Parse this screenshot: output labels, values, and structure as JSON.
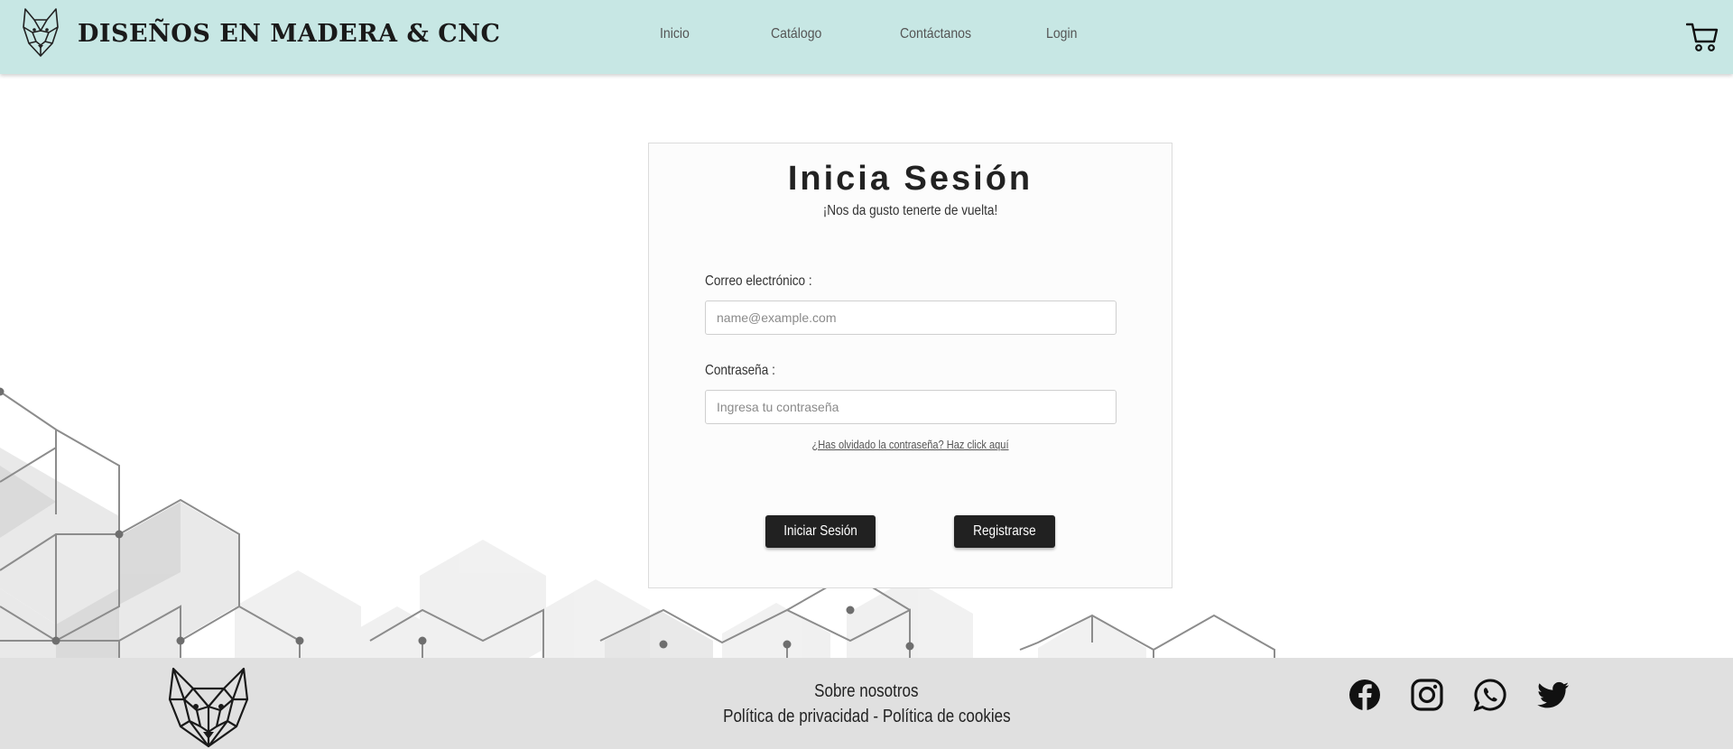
{
  "header": {
    "brand_name": "DISEÑOS EN MADERA & CNC",
    "logo_icon": "wolf-icon",
    "nav": [
      {
        "label": "Inicio"
      },
      {
        "label": "Catálogo"
      },
      {
        "label": "Contáctanos"
      },
      {
        "label": "Login"
      }
    ],
    "cart_icon": "cart-icon"
  },
  "login": {
    "title": "Inicia Sesión",
    "subtitle": "¡Nos da gusto tenerte de vuelta!",
    "email_label": "Correo electrónico :",
    "email_placeholder": "name@example.com",
    "email_value": "",
    "password_label": "Contraseña :",
    "password_placeholder": "Ingresa tu contraseña",
    "password_value": "",
    "forgot_link": "¿Has olvidado la contraseña? Haz click aquí",
    "login_button": "Iniciar Sesión",
    "register_button": "Registrarse"
  },
  "footer": {
    "logo_icon": "wolf-icon",
    "about": "Sobre nosotros",
    "privacy": "Política de privacidad",
    "separator": "-",
    "cookies": "Política de cookies",
    "social_icons": [
      "facebook-icon",
      "instagram-icon",
      "whatsapp-icon",
      "twitter-icon"
    ]
  },
  "colors": {
    "header_bg": "#c7e7e4",
    "footer_bg": "#e0e0e0",
    "button_bg": "#212121"
  }
}
